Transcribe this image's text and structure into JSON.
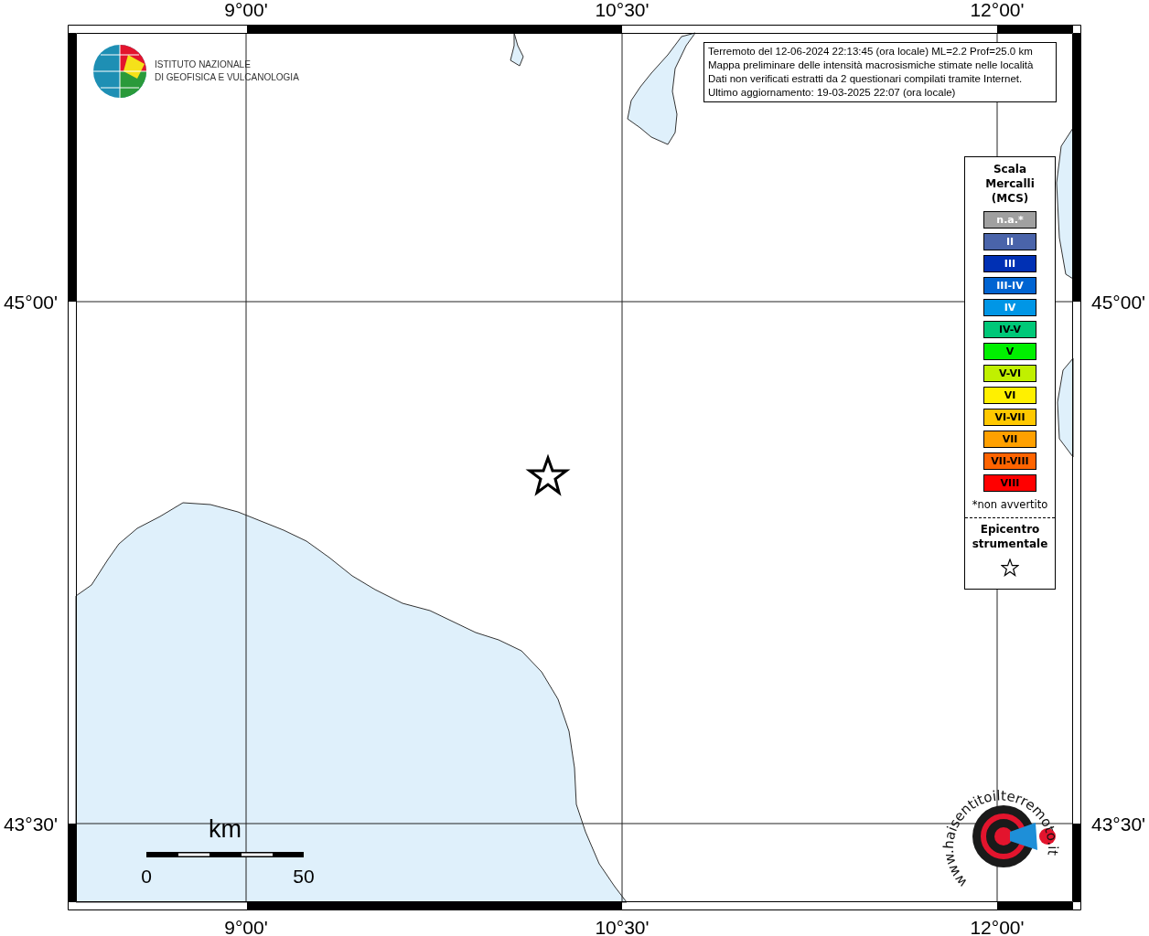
{
  "map": {
    "top_ticks": [
      "9°00'",
      "10°30'",
      "12°00'"
    ],
    "bottom_ticks": [
      "9°00'",
      "10°30'",
      "12°00'"
    ],
    "left_ticks": [
      "45°00'",
      "43°30'"
    ],
    "right_ticks": [
      "45°00'",
      "43°30'"
    ]
  },
  "institute": {
    "lines": [
      "ISTITUTO NAZIONALE",
      "DI GEOFISICA E VULCANOLOGIA"
    ]
  },
  "info_box": {
    "lines": [
      "Terremoto del 12-06-2024 22:13:45 (ora locale) ML=2.2 Prof=25.0 km",
      "Mappa preliminare delle intensità macrosismiche stimate nelle località",
      "Dati non verificati estratti da 2 questionari compilati tramite Internet.",
      "Ultimo aggiornamento: 19-03-2025 22:07 (ora locale)"
    ]
  },
  "legend": {
    "title": [
      "Scala",
      "Mercalli",
      "(MCS)"
    ],
    "items": [
      {
        "label": "n.a.*",
        "color": "#a0a0a0"
      },
      {
        "label": "II",
        "color": "#4a64aa"
      },
      {
        "label": "III",
        "color": "#0030b4"
      },
      {
        "label": "III-IV",
        "color": "#0064d2"
      },
      {
        "label": "IV",
        "color": "#0096e6"
      },
      {
        "label": "IV-V",
        "color": "#00c878"
      },
      {
        "label": "V",
        "color": "#00f000"
      },
      {
        "label": "V-VI",
        "color": "#c0f000"
      },
      {
        "label": "VI",
        "color": "#fff000"
      },
      {
        "label": "VI-VII",
        "color": "#ffc800"
      },
      {
        "label": "VII",
        "color": "#ffa000"
      },
      {
        "label": "VII-VIII",
        "color": "#ff6400"
      },
      {
        "label": "VIII",
        "color": "#ff0000"
      }
    ],
    "note": "*non avvertito",
    "epicenter_title": [
      "Epicentro",
      "strumentale"
    ]
  },
  "scale_bar": {
    "unit": "km",
    "labels": [
      "0",
      "50"
    ]
  },
  "site_logo": {
    "text": "www.haisentitoilterremoto.it"
  }
}
